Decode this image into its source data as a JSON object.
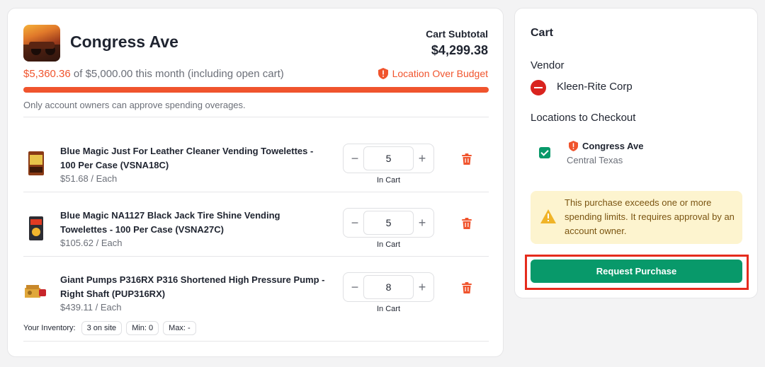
{
  "location": {
    "title": "Congress Ave",
    "subtotal_label": "Cart Subtotal",
    "subtotal_value": "$4,299.38",
    "spend_amount": "$5,360.36",
    "spend_rest": "of $5,000.00 this month (including open cart)",
    "budget_badge": "Location Over Budget",
    "budget_used_fraction": 1.0,
    "approve_note": "Only account owners can approve spending overages."
  },
  "items": [
    {
      "name": "Blue Magic Just For Leather Cleaner Vending Towelettes - 100 Per Case (VSNA18C)",
      "price": "$51.68 / Each",
      "quantity": "5",
      "in_cart": "In Cart"
    },
    {
      "name": "Blue Magic NA1127 Black Jack Tire Shine Vending Towelettes - 100 Per Case (VSNA27C)",
      "price": "$105.62 / Each",
      "quantity": "5",
      "in_cart": "In Cart"
    },
    {
      "name": "Giant Pumps P316RX P316 Shortened High Pressure Pump - Right Shaft (PUP316RX)",
      "price": "$439.11 / Each",
      "quantity": "8",
      "in_cart": "In Cart"
    }
  ],
  "inventory": {
    "label": "Your Inventory:",
    "on_site": "3 on site",
    "min": "Min: 0",
    "max": "Max: -"
  },
  "cart": {
    "title": "Cart",
    "vendor_label": "Vendor",
    "vendor_name": "Kleen-Rite Corp",
    "locations_label": "Locations to Checkout",
    "location_name": "Congress Ave",
    "location_region": "Central Texas",
    "location_checked": true,
    "warning": "This purchase exceeds one or more spending limits. It requires approval by an account owner.",
    "request_button": "Request Purchase"
  },
  "colors": {
    "accent_green": "#08996a",
    "alert_orange": "#f0542d",
    "warning_bg": "#fdf4cf",
    "highlight_red": "#e52b1c"
  }
}
